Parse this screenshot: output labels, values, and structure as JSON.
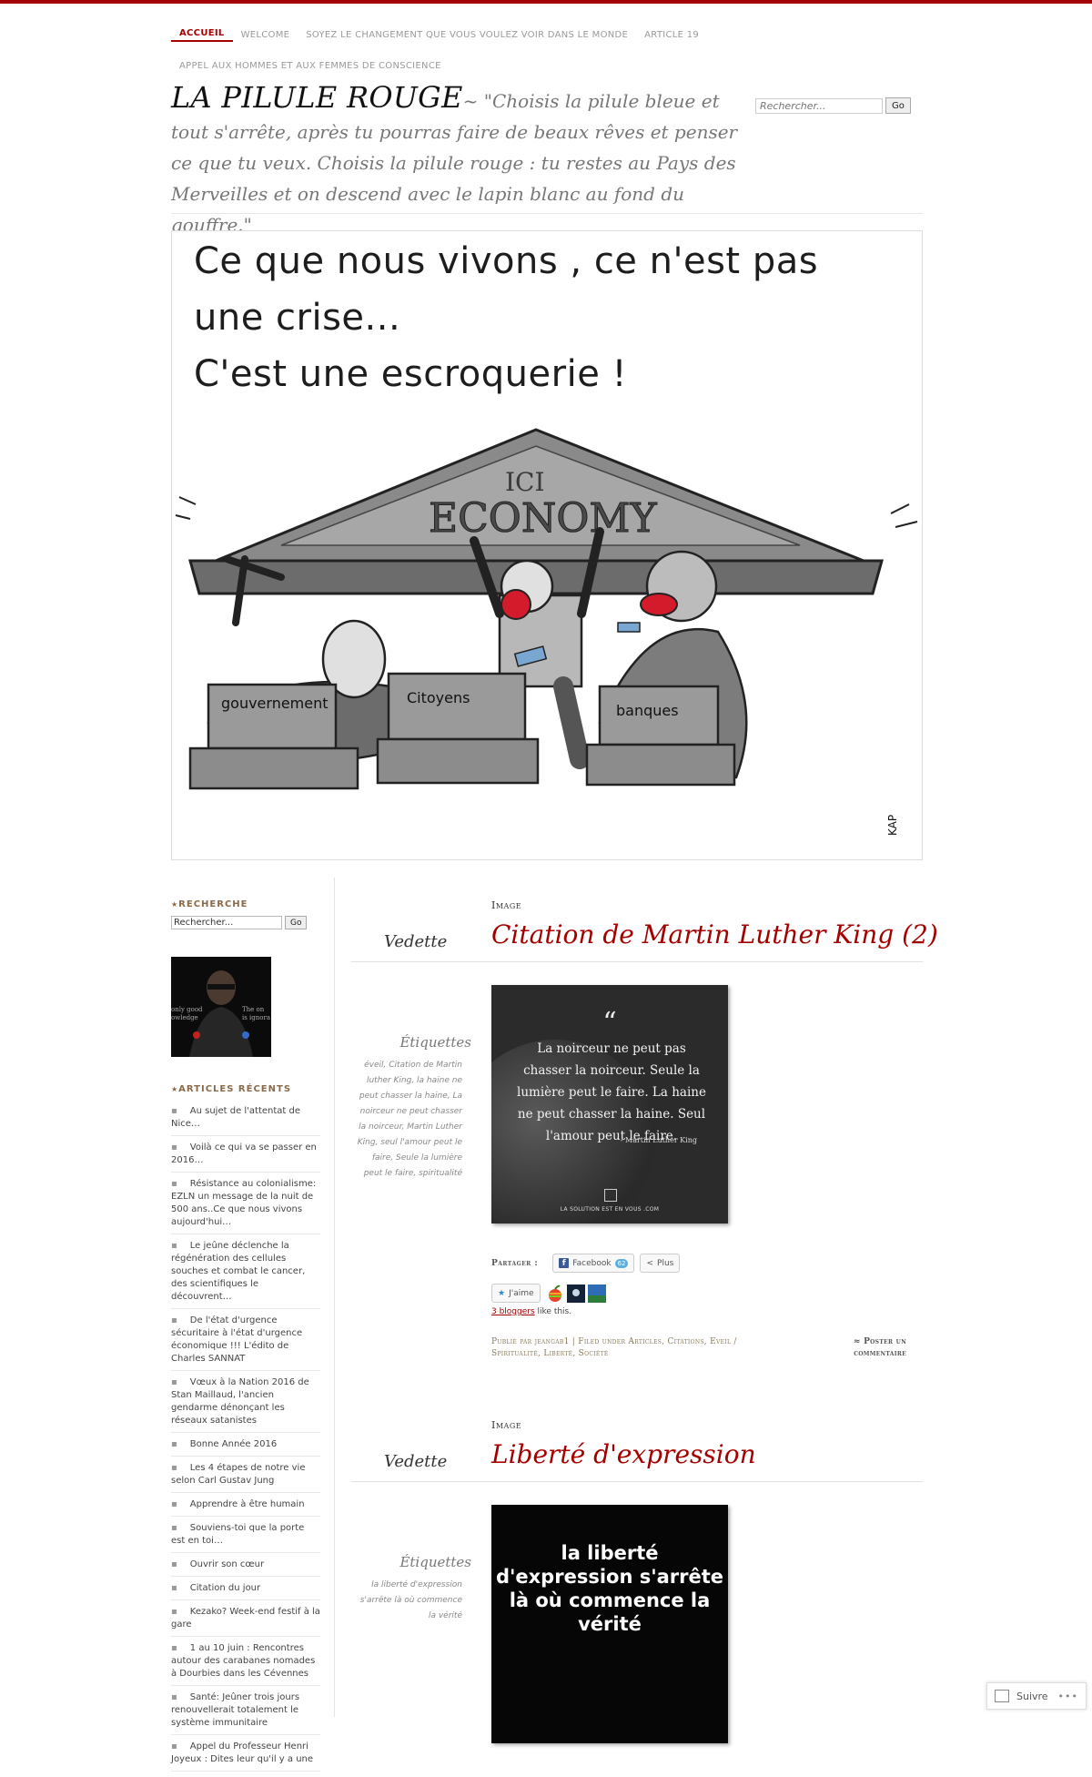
{
  "nav": {
    "row1": [
      "ACCUEIL",
      "WELCOME",
      "SOYEZ LE CHANGEMENT QUE VOUS VOULEZ VOIR DANS LE MONDE",
      "ARTICLE 19"
    ],
    "row2": [
      "APPEL AUX HOMMES ET AUX FEMMES DE CONSCIENCE"
    ]
  },
  "site": {
    "title": "LA PILULE ROUGE",
    "tagline": "~ \"Choisis la pilule bleue et tout s'arrête, après tu pourras faire de beaux rêves et penser ce que tu veux. Choisis la pilule rouge : tu restes au Pays des Merveilles et on descend avec le lapin blanc au fond du gouffre.\""
  },
  "top_search": {
    "placeholder": "Rechercher...",
    "button": "Go"
  },
  "hero": {
    "lines": [
      "Ce que nous vivons , ce n'est pas",
      "une crise...",
      "C'est une escroquerie !"
    ],
    "pediment_top": "ICI",
    "pediment": "ECONOMY",
    "pillars": [
      "gouvernement",
      "Citoyens",
      "banques"
    ],
    "signature": "KAP"
  },
  "sidebar": {
    "search_title": "RECHERCHE",
    "search_value": "Rechercher...",
    "search_button": "Go",
    "avatar_left": "only good\nowledge",
    "avatar_right": "The on\nis ignora",
    "recent_title": "ARTICLES RÉCENTS",
    "recent": [
      "Au sujet de l'attentat de Nice…",
      "Voilà ce qui va se passer en 2016…",
      "Résistance au colonialisme: EZLN un message de la nuit de 500 ans..Ce que nous vivons aujourd'hui…",
      "Le jeûne déclenche la régénération des cellules souches et combat le cancer, des scientifiques le découvrent…",
      "De l'état d'urgence sécuritaire à l'état d'urgence économique !!! L'édito de Charles SANNAT",
      "Vœux à la Nation 2016 de Stan Maillaud, l'ancien gendarme dénonçant les réseaux satanistes",
      "Bonne Année 2016",
      "Les 4 étapes de notre vie selon Carl Gustav Jung",
      "Apprendre à être humain",
      "Souviens-toi que la porte est en toi…",
      "Ouvrir son cœur",
      "Citation du jour",
      "Kezako? Week-end festif à la gare",
      "1 au 10 juin : Rencontres autour des carabanes nomades à Dourbies dans les Cévennes",
      "Santé: Jeûner trois jours renouvellerait totalement le système immunitaire",
      "Appel du Professeur Henri Joyeux : Dites leur qu'il y a une"
    ]
  },
  "posts": [
    {
      "type": "Image",
      "featured": "Vedette",
      "title": "Citation de Martin Luther King (2)",
      "tags_label": "Étiquettes",
      "tags": "éveil, Citation de Martin luther King, la haine ne peut chasser la haine, La noirceur ne peut chasser la noirceur, Martin Luther King, seul l'amour peut le faire, Seule la lumière peut le faire, spiritualité",
      "image": {
        "quote_mark": "“",
        "text": "La noirceur ne peut pas chasser la noirceur. Seule la lumière peut le faire. La haine ne peut chasser la haine. Seul l'amour peut le faire.",
        "author": "- Martin Luther King",
        "footer": "LA SOLUTION EST EN VOUS .COM"
      },
      "share_label": "Partager :",
      "facebook": "Facebook",
      "facebook_count": "62",
      "more": "Plus",
      "like": "J'aime",
      "likers_link": "3 bloggers",
      "likers_suffix": " like this.",
      "meta": "Publié par jeangab1 | Filed under Articles, Citations, Eveil / Spiritualité, Liberté, Société",
      "comment": "≈ Poster un commentaire"
    },
    {
      "type": "Image",
      "featured": "Vedette",
      "title": "Liberté d'expression",
      "tags_label": "Étiquettes",
      "tags": "la liberté d'expression s'arrête là où commence la vérité",
      "image": {
        "text": "la liberté d'expression s'arrête là où commence la vérité"
      }
    }
  ],
  "follow": {
    "label": "Suivre",
    "dots": "•••"
  },
  "colors": {
    "accent": "#a50000",
    "meta": "#8a7a5a"
  }
}
